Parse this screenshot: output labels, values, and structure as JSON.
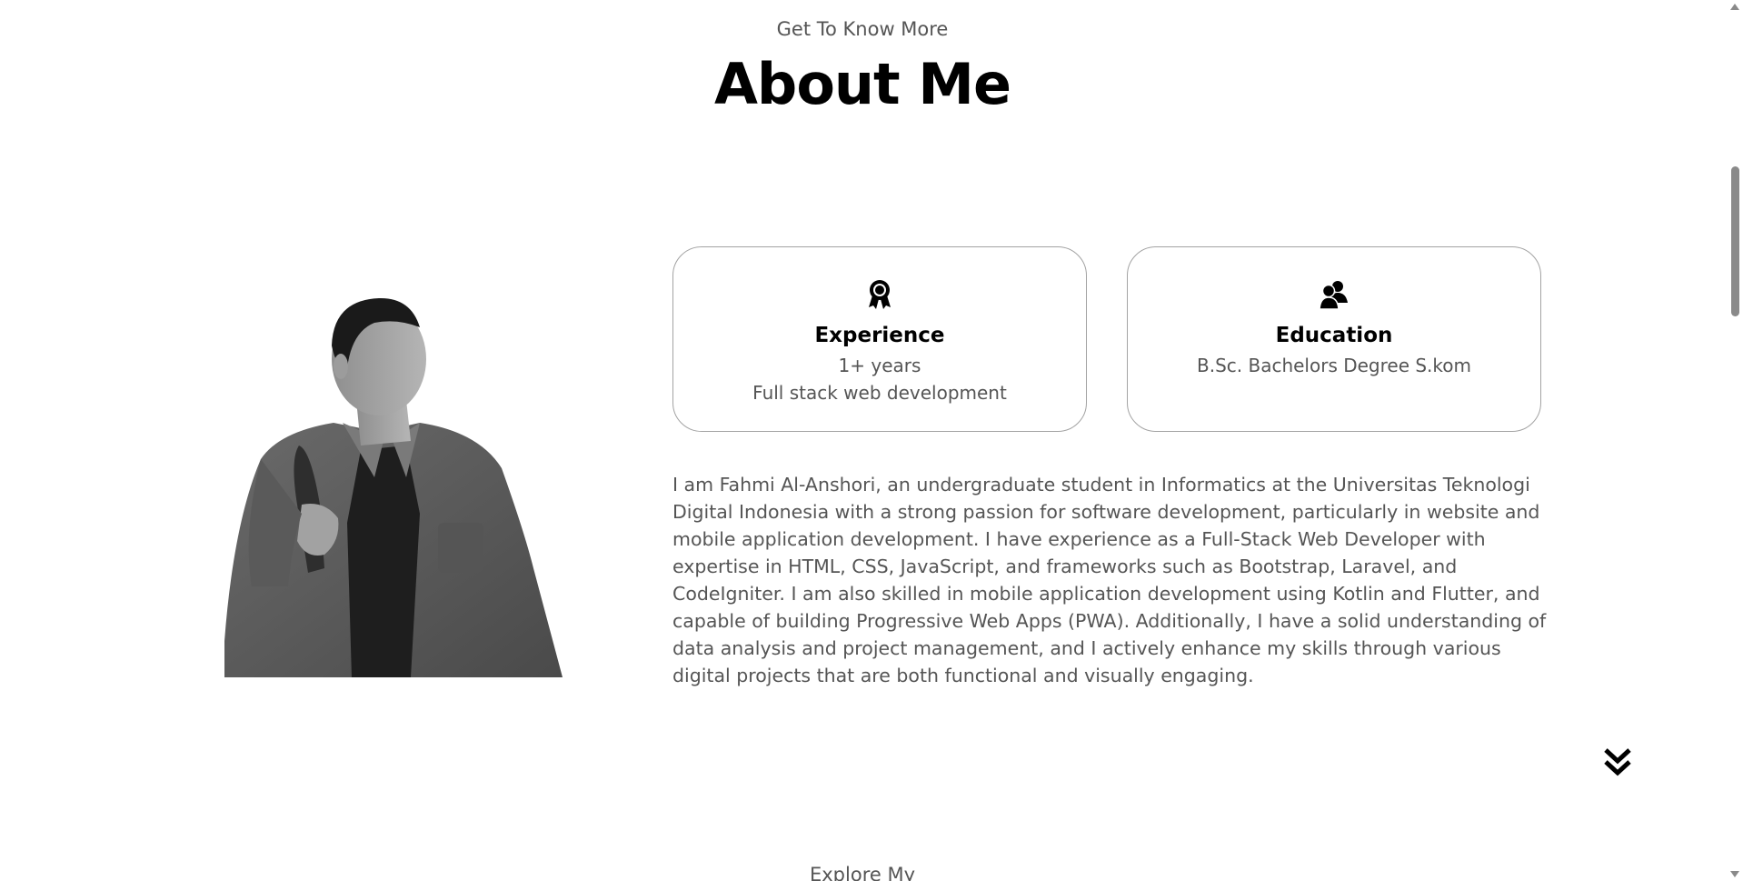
{
  "about": {
    "subtitle": "Get To Know More",
    "title": "About Me",
    "photo_alt": "profile-photo"
  },
  "cards": {
    "experience": {
      "icon": "award-ribbon-icon",
      "title": "Experience",
      "line1": "1+ years",
      "line2": "Full stack web development"
    },
    "education": {
      "icon": "users-icon",
      "title": "Education",
      "line1": "B.Sc. Bachelors Degree S.kom"
    }
  },
  "bio": "I am Fahmi Al-Anshori, an undergraduate student in Informatics at the Universitas Teknologi Digital Indonesia with a strong passion for software development, particularly in website and mobile application development. I have experience as a Full-Stack Web Developer with expertise in HTML, CSS, JavaScript, and frameworks such as Bootstrap, Laravel, and CodeIgniter. I am also skilled in mobile application development using Kotlin and Flutter, and capable of building Progressive Web Apps (PWA). Additionally, I have a solid understanding of data analysis and project management, and I actively enhance my skills through various digital projects that are both functional and visually engaging.",
  "next_section": {
    "label": "Explore My",
    "arrow_icon": "double-chevron-down-icon"
  },
  "colors": {
    "text": "#555555",
    "heading": "#000000",
    "border": "#a3a3a3",
    "background": "#ffffff"
  }
}
